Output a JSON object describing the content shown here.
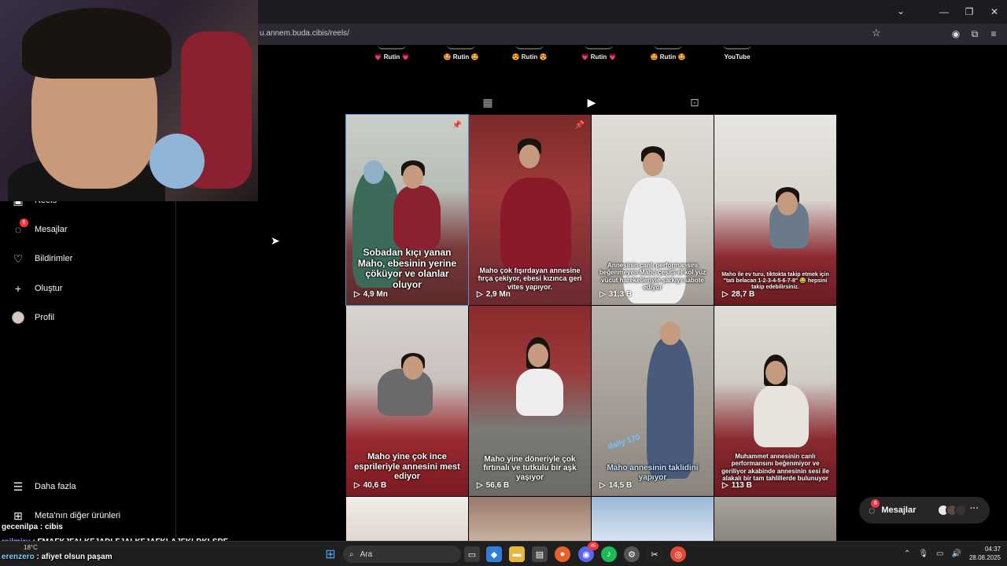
{
  "browser": {
    "url": "u.annem.buda.cibis/reels/",
    "tab_dropdown_icon": "chevron-down-icon",
    "window_controls": [
      "minimize-icon",
      "maximize-icon",
      "close-icon"
    ]
  },
  "highlights": [
    {
      "label": "💗 Rutin 💗"
    },
    {
      "label": "🤩 Rutin 🤩"
    },
    {
      "label": "😍 Rutin 😍"
    },
    {
      "label": "💗 Rutin 💗"
    },
    {
      "label": "🤩 Rutin 🤩"
    },
    {
      "label": "YouTube"
    }
  ],
  "sidebar": {
    "items": [
      {
        "label": "Reels",
        "icon": "reels-icon"
      },
      {
        "label": "Mesajlar",
        "icon": "messenger-icon",
        "badge": "6"
      },
      {
        "label": "Bildirimler",
        "icon": "heart-icon"
      },
      {
        "label": "Oluştur",
        "icon": "plus-icon"
      },
      {
        "label": "Profil",
        "icon": "avatar"
      }
    ],
    "more_label": "Daha fazla",
    "meta_label": "Meta'nın diğer ürünleri"
  },
  "profile_tabs": [
    {
      "name": "posts",
      "icon": "grid-icon",
      "active": false
    },
    {
      "name": "reels",
      "icon": "reels-icon",
      "active": true
    },
    {
      "name": "tagged",
      "icon": "tagged-icon",
      "active": false
    }
  ],
  "reels": [
    {
      "caption": "Sobadan kıçı yanan Maho, ebesinin yerine çöküyor ve olanlar oluyor",
      "views": "4,9 Mn",
      "pinned": true
    },
    {
      "caption": "Maho çok fışırdayan annesine fırça çekiyor, ebesi kızınca geri vites yapıyor.",
      "views": "2,9 Mn",
      "pinned": true
    },
    {
      "caption": "Annesinin canlı performansını beğenmeyen Maho çeşitli el kol yüz vücut hareketleriyle şarkıyı sabote ediyor",
      "views": "31,3 B",
      "pinned": false
    },
    {
      "caption": "Maho ile ev turu, tiktokta takip etmek için \"tati belacan 1-2-3-4-5-6-7-8\" 😂 hepsini takip edebilirsiniz.",
      "views": "28,7 B",
      "pinned": false
    },
    {
      "caption": "Maho yine çok ince esprileriyle annesini mest ediyor",
      "views": "40,6 B",
      "pinned": false
    },
    {
      "caption": "Maho yine döneriyle çok fırtınalı ve tutkulu bir aşk yaşıyor",
      "views": "56,6 B",
      "pinned": false
    },
    {
      "caption": "Maho annesinin taklidini yapıyor",
      "overlay_text": "daily 170",
      "views": "14,5 B",
      "pinned": false
    },
    {
      "caption": "Muhammet annesinin canlı performansını beğenmiyor ve geriliyor akabinde annesinin sesi ile alakalı bir tam tahlillerde bulunuyor",
      "views": "113 B",
      "pinned": false
    }
  ],
  "messages_pill": {
    "label": "Mesajlar",
    "badge": "6"
  },
  "chat": [
    {
      "user": "gecenilpa",
      "text": "cibis"
    },
    {
      "user": "reilmiru",
      "text": "FMAFKJFALKFJADLFJALKFJAFKLAJFKLDKLŞDF"
    },
    {
      "user": "erenzero",
      "text": "afiyet olsun paşam"
    }
  ],
  "taskbar": {
    "search_placeholder": "Ara",
    "weather": "18°C",
    "time": "04:37",
    "date": "28.08.2025",
    "discord_badge": "45"
  },
  "colors": {
    "accent_blue": "#5b8cd8",
    "badge_red": "#ff3040",
    "background": "#000000"
  }
}
